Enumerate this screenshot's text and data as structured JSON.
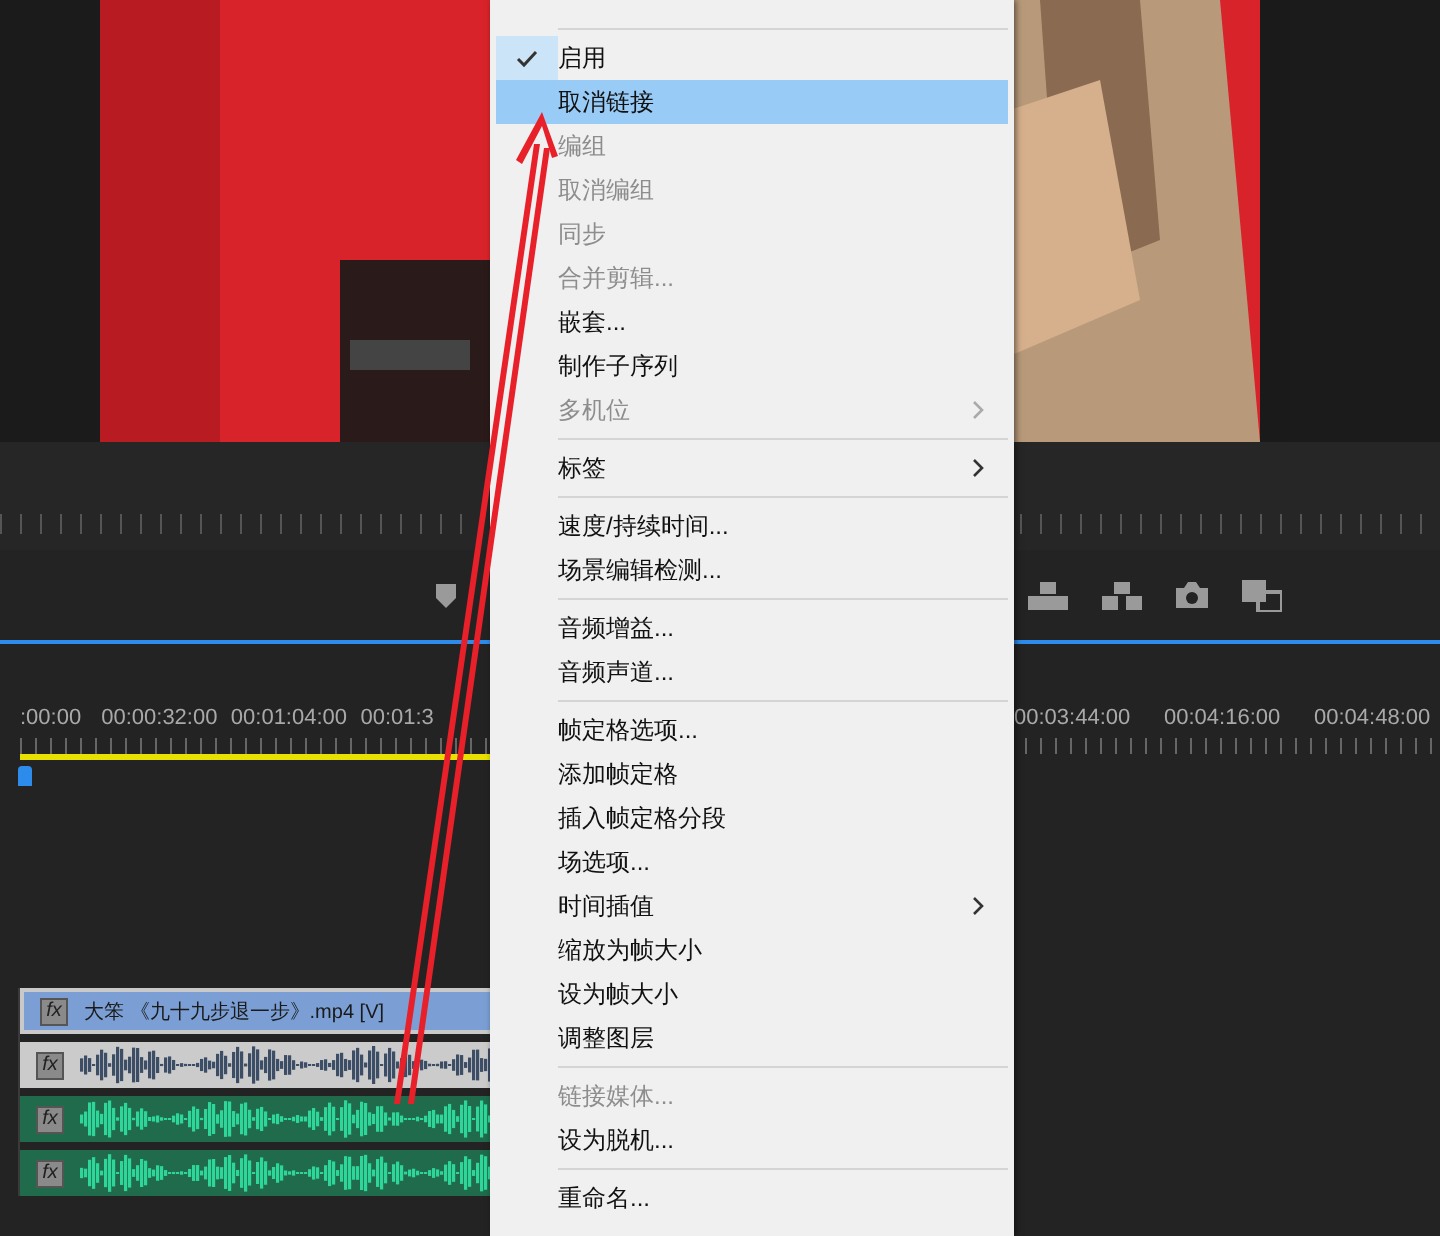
{
  "menu": {
    "items": [
      {
        "kind": "separator"
      },
      {
        "kind": "item",
        "label": "启用",
        "disabled": false,
        "checked": true,
        "selected": false,
        "submenu": false
      },
      {
        "kind": "item",
        "label": "取消链接",
        "disabled": false,
        "checked": false,
        "selected": true,
        "submenu": false
      },
      {
        "kind": "item",
        "label": "编组",
        "disabled": true,
        "checked": false,
        "selected": false,
        "submenu": false
      },
      {
        "kind": "item",
        "label": "取消编组",
        "disabled": true,
        "checked": false,
        "selected": false,
        "submenu": false
      },
      {
        "kind": "item",
        "label": "同步",
        "disabled": true,
        "checked": false,
        "selected": false,
        "submenu": false
      },
      {
        "kind": "item",
        "label": "合并剪辑...",
        "disabled": true,
        "checked": false,
        "selected": false,
        "submenu": false
      },
      {
        "kind": "item",
        "label": "嵌套...",
        "disabled": false,
        "checked": false,
        "selected": false,
        "submenu": false
      },
      {
        "kind": "item",
        "label": "制作子序列",
        "disabled": false,
        "checked": false,
        "selected": false,
        "submenu": false
      },
      {
        "kind": "item",
        "label": "多机位",
        "disabled": true,
        "checked": false,
        "selected": false,
        "submenu": true
      },
      {
        "kind": "separator"
      },
      {
        "kind": "item",
        "label": "标签",
        "disabled": false,
        "checked": false,
        "selected": false,
        "submenu": true
      },
      {
        "kind": "separator"
      },
      {
        "kind": "item",
        "label": "速度/持续时间...",
        "disabled": false,
        "checked": false,
        "selected": false,
        "submenu": false
      },
      {
        "kind": "item",
        "label": "场景编辑检测...",
        "disabled": false,
        "checked": false,
        "selected": false,
        "submenu": false
      },
      {
        "kind": "separator"
      },
      {
        "kind": "item",
        "label": "音频增益...",
        "disabled": false,
        "checked": false,
        "selected": false,
        "submenu": false
      },
      {
        "kind": "item",
        "label": "音频声道...",
        "disabled": false,
        "checked": false,
        "selected": false,
        "submenu": false
      },
      {
        "kind": "separator"
      },
      {
        "kind": "item",
        "label": "帧定格选项...",
        "disabled": false,
        "checked": false,
        "selected": false,
        "submenu": false
      },
      {
        "kind": "item",
        "label": "添加帧定格",
        "disabled": false,
        "checked": false,
        "selected": false,
        "submenu": false
      },
      {
        "kind": "item",
        "label": "插入帧定格分段",
        "disabled": false,
        "checked": false,
        "selected": false,
        "submenu": false
      },
      {
        "kind": "item",
        "label": "场选项...",
        "disabled": false,
        "checked": false,
        "selected": false,
        "submenu": false
      },
      {
        "kind": "item",
        "label": "时间插值",
        "disabled": false,
        "checked": false,
        "selected": false,
        "submenu": true
      },
      {
        "kind": "item",
        "label": "缩放为帧大小",
        "disabled": false,
        "checked": false,
        "selected": false,
        "submenu": false
      },
      {
        "kind": "item",
        "label": "设为帧大小",
        "disabled": false,
        "checked": false,
        "selected": false,
        "submenu": false
      },
      {
        "kind": "item",
        "label": "调整图层",
        "disabled": false,
        "checked": false,
        "selected": false,
        "submenu": false
      },
      {
        "kind": "separator"
      },
      {
        "kind": "item",
        "label": "链接媒体...",
        "disabled": true,
        "checked": false,
        "selected": false,
        "submenu": false
      },
      {
        "kind": "item",
        "label": "设为脱机...",
        "disabled": false,
        "checked": false,
        "selected": false,
        "submenu": false
      },
      {
        "kind": "separator"
      },
      {
        "kind": "item",
        "label": "重命名...",
        "disabled": false,
        "checked": false,
        "selected": false,
        "submenu": false
      }
    ]
  },
  "timeline": {
    "timecodes_left": [
      ":00:00",
      "00:00:32:00",
      "00:01:04:00",
      "00:01:3"
    ],
    "timecodes_right": [
      "00:03:44:00",
      "00:04:16:00",
      "00:04:48:00"
    ],
    "tracks": [
      {
        "kind": "video",
        "badge": "fx",
        "label": "大笨 《九十九步退一步》.mp4 [V]"
      },
      {
        "kind": "audio-muted",
        "badge": "fx"
      },
      {
        "kind": "audio",
        "badge": "fx"
      },
      {
        "kind": "audio",
        "badge": "fx"
      }
    ]
  }
}
